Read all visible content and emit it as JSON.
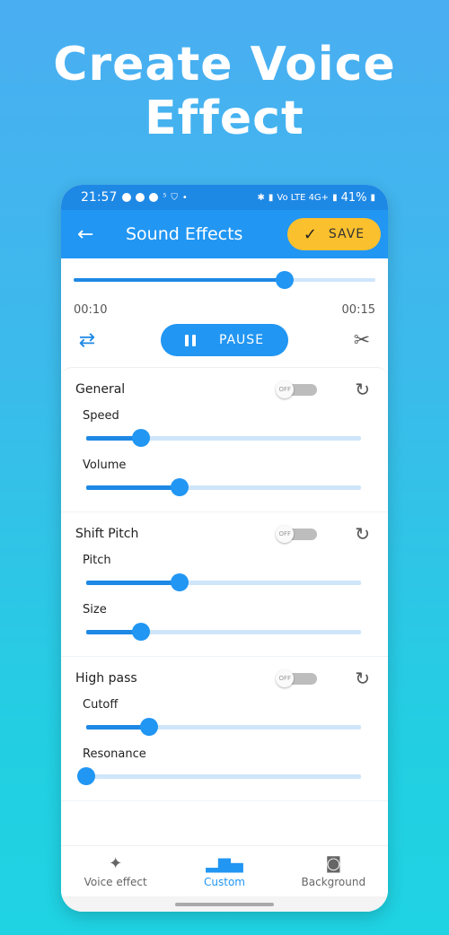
{
  "headline": {
    "line1": "Create Voice",
    "line2": "Effect"
  },
  "statusbar": {
    "time": "21:57",
    "notif_icons": [
      "messenger-icon",
      "messenger-icon",
      "facebook-icon",
      "data-icon",
      "shield-icon",
      "dot-icon"
    ],
    "network_text": "Vo LTE 4G+",
    "battery": "41%"
  },
  "appbar": {
    "title": "Sound Effects",
    "save_label": "SAVE",
    "back_icon": "arrow-left-icon",
    "save_icon": "check-icon"
  },
  "player": {
    "progress": 0.7,
    "current_time": "00:10",
    "total_time": "00:15",
    "pause_label": "PAUSE",
    "repeat_icon": "repeat-icon",
    "cut_icon": "scissors-icon"
  },
  "sections": [
    {
      "title": "General",
      "toggle": "OFF",
      "params": [
        {
          "label": "Speed",
          "value": 0.2
        },
        {
          "label": "Volume",
          "value": 0.34
        }
      ]
    },
    {
      "title": "Shift Pitch",
      "toggle": "OFF",
      "params": [
        {
          "label": "Pitch",
          "value": 0.34
        },
        {
          "label": "Size",
          "value": 0.2
        }
      ]
    },
    {
      "title": "High pass",
      "toggle": "OFF",
      "params": [
        {
          "label": "Cutoff",
          "value": 0.23
        },
        {
          "label": "Resonance",
          "value": 0.0
        }
      ]
    }
  ],
  "bottom_nav": [
    {
      "label": "Voice effect",
      "icon": "magic-wand-icon",
      "active": false
    },
    {
      "label": "Custom",
      "icon": "equalizer-icon",
      "active": true
    },
    {
      "label": "Background",
      "icon": "background-sound-icon",
      "active": false
    }
  ],
  "colors": {
    "primary": "#2196f3",
    "save": "#fbc02d",
    "track": "#cfe5fa"
  }
}
